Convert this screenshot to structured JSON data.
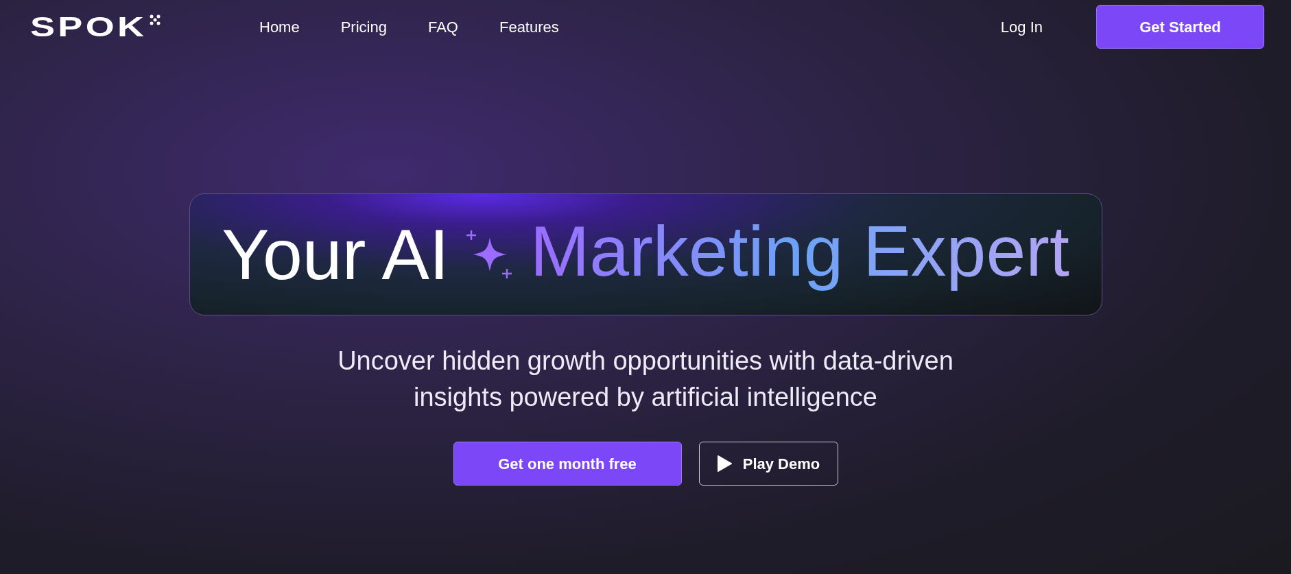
{
  "logo": {
    "text": "SPOK"
  },
  "nav": [
    {
      "label": "Home"
    },
    {
      "label": "Pricing"
    },
    {
      "label": "FAQ"
    },
    {
      "label": "Features"
    }
  ],
  "login": "Log In",
  "get_started": "Get Started",
  "headline": {
    "lead": "Your AI",
    "highlight": "Marketing Expert"
  },
  "subtitle": "Uncover hidden growth opportunities with data-driven insights powered by artificial intelligence",
  "buttons": [
    {
      "label": "Get one month free",
      "kind": "primary"
    },
    {
      "label": "Play Demo",
      "kind": "outline"
    }
  ]
}
